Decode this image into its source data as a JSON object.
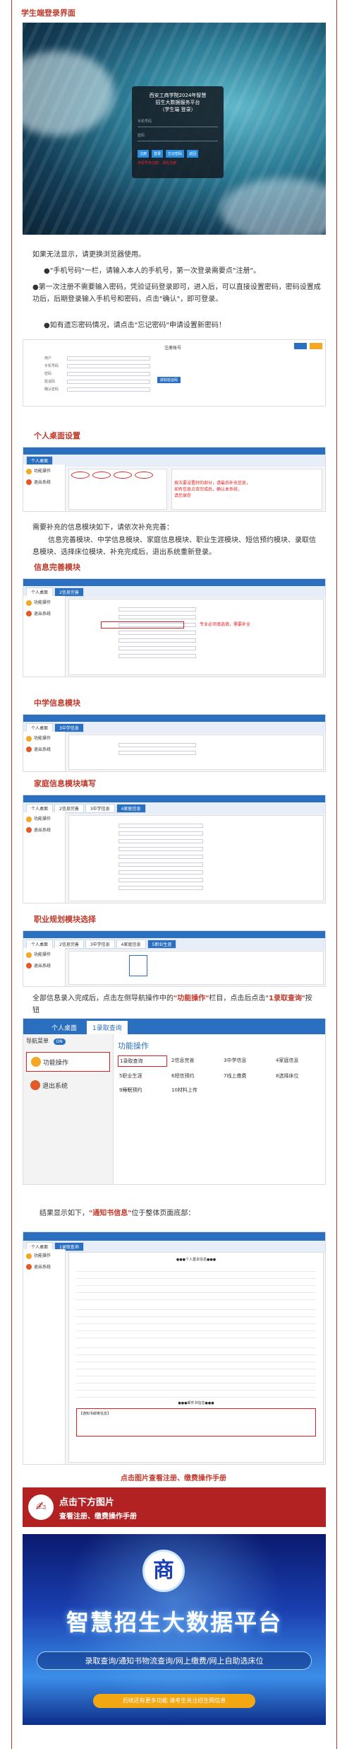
{
  "section_login": {
    "title": "学生端登录界面"
  },
  "login_dialog": {
    "title_line1": "西安工商学院2024年智慧",
    "title_line2": "招生大数据服务平台",
    "title_line3": "（学生端 登录）",
    "field1_label": "手机号码",
    "field2_label": "密码",
    "buttons": [
      "注册",
      "登录",
      "忘记密码",
      "返回"
    ],
    "hint": "手机号未注册，请先注册"
  },
  "intro": {
    "p1": "如果无法显示，请更换浏览器使用。",
    "p2": "●\"手机号码\"一栏，请输入本人的手机号，第一次登录需要点\"注册\"。",
    "p3": "●第一次注册不需要输入密码，凭验证码登录即可，进入后，可以直接设置密码，密码设置成功后，后期登录输入手机号和密码，点击\"确认\"，即可登录。",
    "p4": "●如有遗忘密码情况，请点击\"忘记密码\"申请设置新密码！"
  },
  "reg_form": {
    "title": "注册账号",
    "labels": [
      "用户",
      "手机号码",
      "密码",
      "验证码",
      "确认密码"
    ],
    "code_btn": "获取验证码"
  },
  "section_desktop": {
    "title": "个人桌面设置"
  },
  "desktop_note": {
    "line1": "按次要设置好的部分，请最后补充信息，",
    "line2": "如有信息点击完成后，确认本系统，",
    "line3": "请您保存"
  },
  "paragraph2": {
    "p1": "需要补充的信息模块如下，请依次补充完善：",
    "p2": "信息完善模块、中学信息模块、家庭信息模块、职业生涯模块、短信预约模块、录取信息模块、选择床位模块、补充完成后，退出系统重新登录。"
  },
  "section_info": {
    "title": "信息完善模块"
  },
  "info_note": "专业必须填选填，需要补全",
  "section_school": {
    "title": "中学信息模块"
  },
  "section_family": {
    "title": "家庭信息模块填写"
  },
  "section_career": {
    "title": "职业规划模块选择"
  },
  "paragraph3": {
    "text_a": "全部信息录入完成后，点击左侧导航操作中的",
    "highlight1": "\"功能操作\"",
    "text_b": "栏目，点击后点击\"",
    "highlight2": "1录取查询",
    "text_c": "\"按钮"
  },
  "func_panel": {
    "tabs": [
      "个人桌面",
      "1录取查询"
    ],
    "nav_label": "导航菜单",
    "toggle": "ON",
    "side_items": [
      "功能操作",
      "退出系统"
    ],
    "heading": "功能操作",
    "items": [
      "1录取查询",
      "2信息完善",
      "3中学信息",
      "4家庭信息",
      "5职业生涯",
      "6短信预约",
      "7线上缴费",
      "8选择床位",
      "9睡眠预约",
      "10材料上传"
    ]
  },
  "paragraph4": {
    "text_a": "结果显示如下，",
    "highlight": "\"通知书信息\"",
    "text_b": "位于整体页面底部："
  },
  "result_shot": {
    "header": "●●●个人基本信息●●●",
    "header2": "●●●邮件书信息●●●",
    "notice": "【通知书邮寄信息】"
  },
  "caption": "点击图片查看注册、缴费操作手册",
  "banner": {
    "line1": "点击下方图片",
    "line2": "查看注册、缴费操作手册"
  },
  "poster": {
    "title": "智慧招生大数据平台",
    "sub": "录取查询/通知书物流查询/网上缴费/网上自助选床位",
    "footer": "后续还有更多功能 请考生关注招生网信息"
  },
  "colors": {
    "accent": "#c0392b",
    "primary_blue": "#2a6fc0"
  }
}
